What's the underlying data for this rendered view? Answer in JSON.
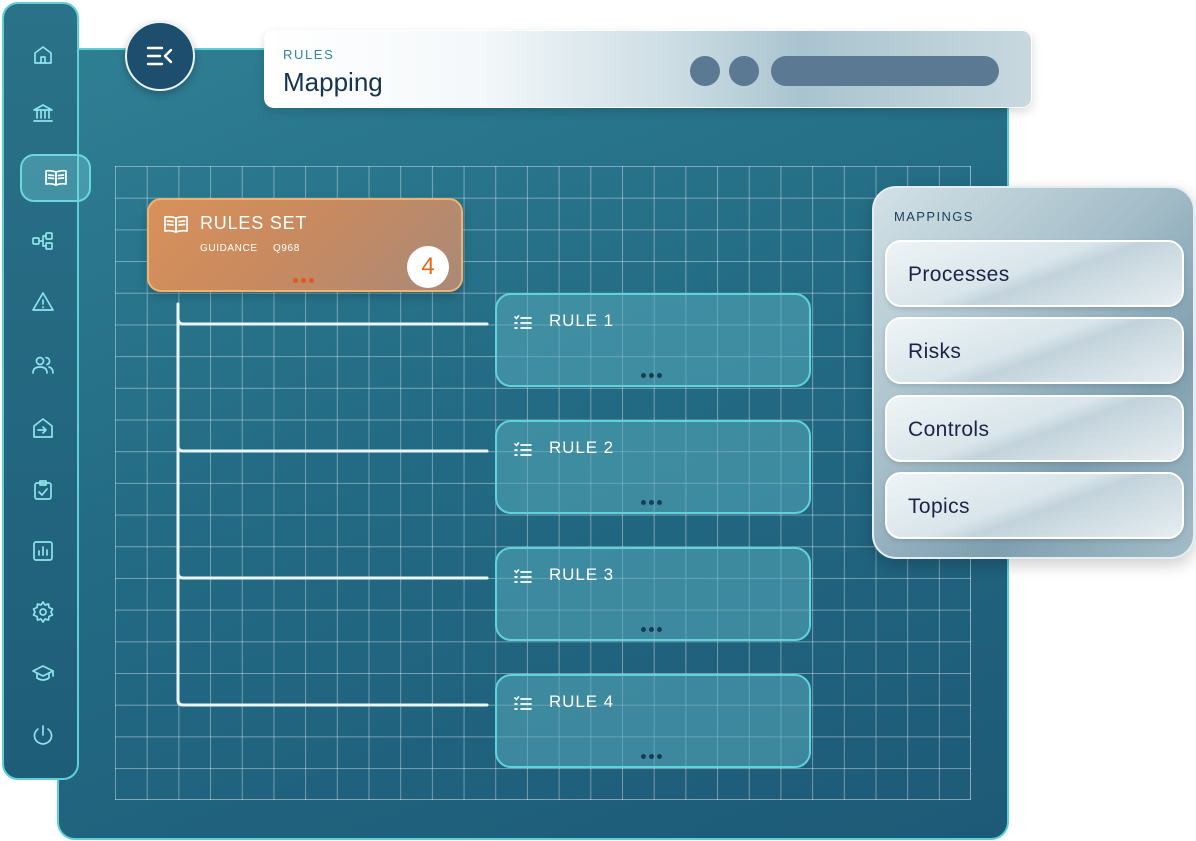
{
  "header": {
    "section": "RULES",
    "title": "Mapping"
  },
  "sidebar": {
    "items": [
      {
        "icon": "home-icon"
      },
      {
        "icon": "bank-icon"
      },
      {
        "icon": "book-icon",
        "active": true
      },
      {
        "icon": "workflow-icon"
      },
      {
        "icon": "warning-icon"
      },
      {
        "icon": "users-icon"
      },
      {
        "icon": "import-icon"
      },
      {
        "icon": "clipboard-check-icon"
      },
      {
        "icon": "report-chart-icon"
      },
      {
        "icon": "settings-icon"
      },
      {
        "icon": "graduation-cap-icon"
      },
      {
        "icon": "power-icon"
      }
    ]
  },
  "rules_set": {
    "title": "RULES SET",
    "meta_left": "GUIDANCE",
    "meta_right": "Q968",
    "count": "4"
  },
  "rules": [
    {
      "title": "RULE 1"
    },
    {
      "title": "RULE 2"
    },
    {
      "title": "RULE 3"
    },
    {
      "title": "RULE 4"
    }
  ],
  "mappings": {
    "title": "MAPPINGS",
    "items": [
      {
        "label": "Processes"
      },
      {
        "label": "Risks"
      },
      {
        "label": "Controls"
      },
      {
        "label": "Topics"
      }
    ]
  },
  "colors": {
    "accent": "#5fd0d8",
    "canvas": "#236b84",
    "rules_set_orange": "#d8915a",
    "badge_number": "#e06a18",
    "nav_icon": "#8fe3ea"
  }
}
